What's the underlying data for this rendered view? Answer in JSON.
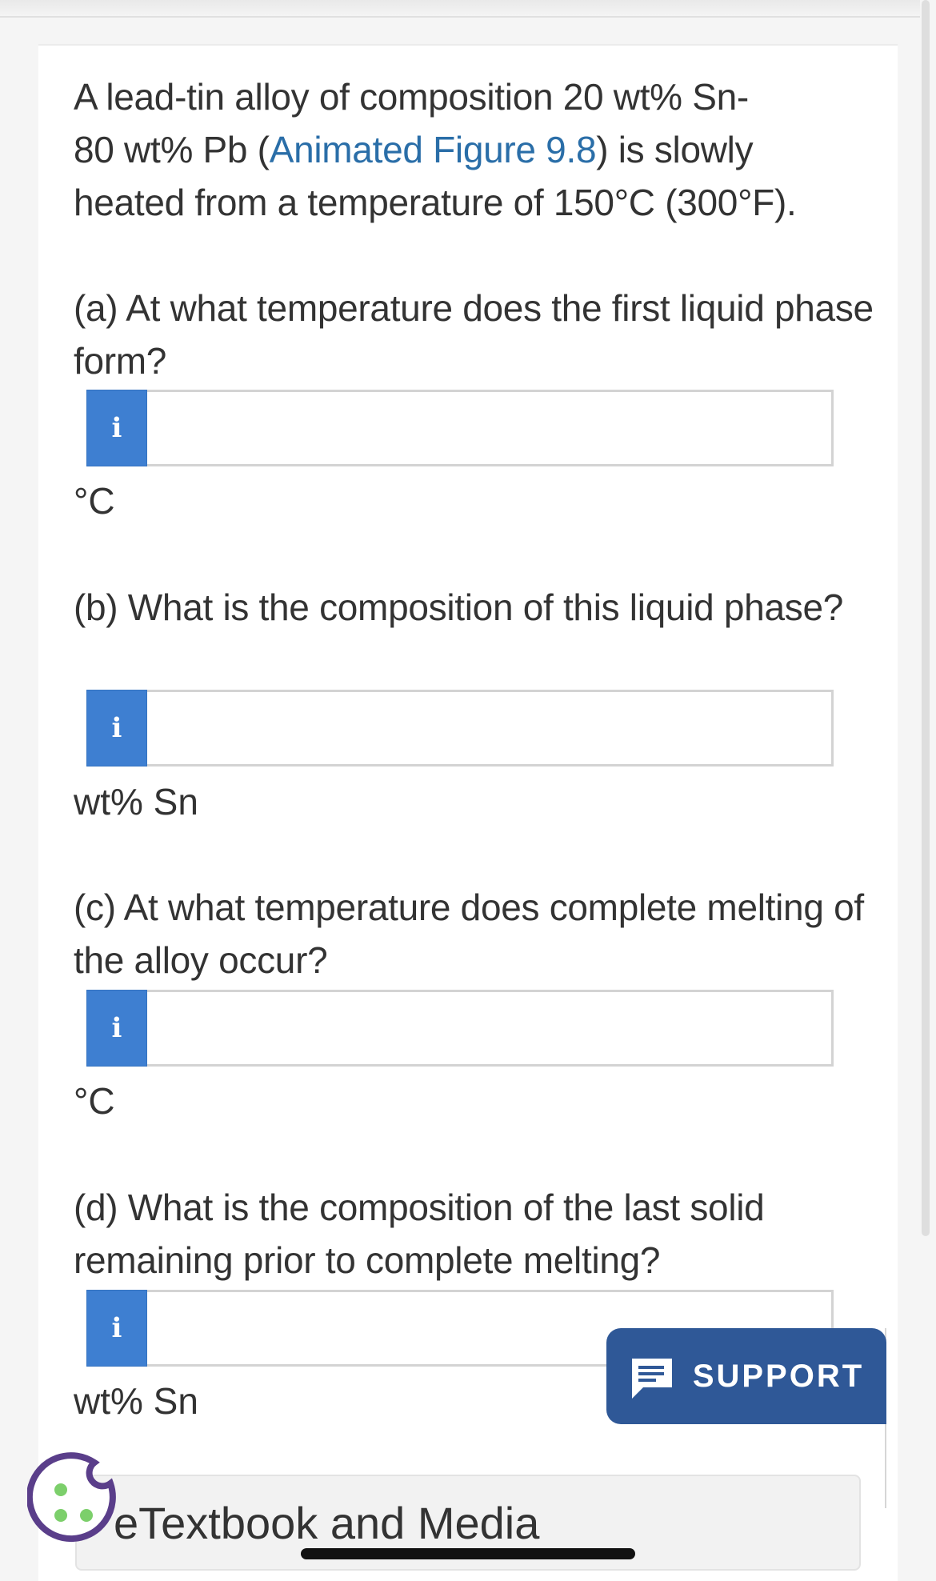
{
  "question": {
    "intro_before_link": "A lead-tin alloy of composition 20 wt% Sn-",
    "intro_line2_prefix": "80 wt% Pb (",
    "link_text": "Animated Figure 9.8",
    "intro_line2_suffix": ") is slowly",
    "intro_line3": "heated from a temperature of 150°C (300°F)."
  },
  "parts": [
    {
      "text": "(a) At what temperature does the first liquid phase form?",
      "info_label": "i",
      "value": "",
      "unit": "°C"
    },
    {
      "text": "(b) What is the composition of this liquid phase?",
      "info_label": "i",
      "value": "",
      "unit": "wt% Sn"
    },
    {
      "text": "(c) At what temperature does complete melting of the alloy occur?",
      "info_label": "i",
      "value": "",
      "unit": "°C"
    },
    {
      "text": "(d) What is the composition of the last solid remaining prior to complete melting?",
      "info_label": "i",
      "value": "",
      "unit": "wt% Sn"
    }
  ],
  "support": {
    "label": "SUPPORT",
    "icon": "chat-lines-icon"
  },
  "textbook": {
    "label": "eTextbook and Media"
  },
  "cookie": {
    "icon": "cookie-icon"
  },
  "colors": {
    "link": "#2a6ea8",
    "info_button": "#3e7fd1",
    "support": "#2f5897",
    "cookie": "#5a3e8a",
    "cookie_dots": "#7ccf6b"
  }
}
